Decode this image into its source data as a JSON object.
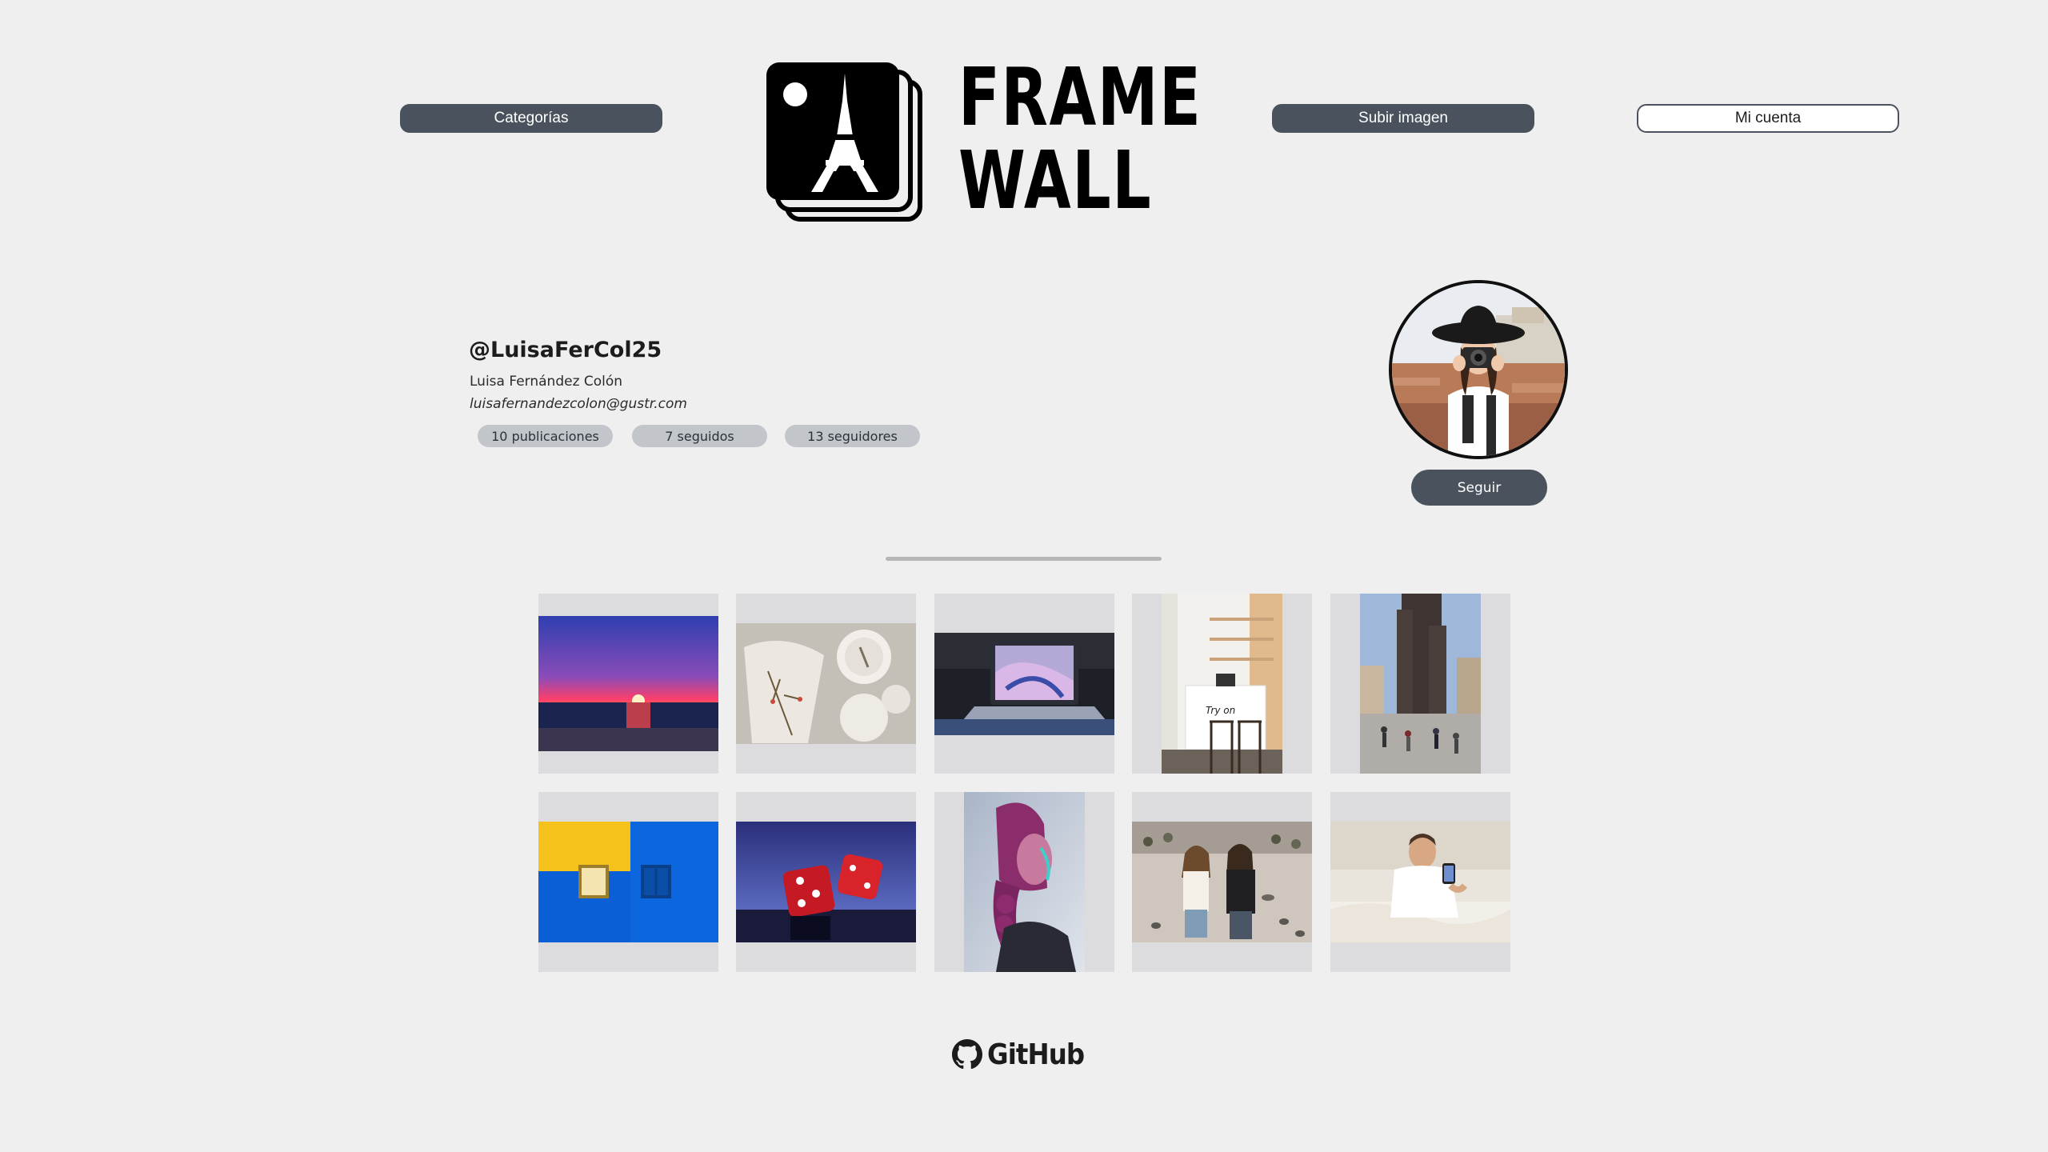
{
  "header": {
    "categories_label": "Categorías",
    "upload_label": "Subir imagen",
    "account_label": "Mi cuenta",
    "logo": {
      "line1": "FRAME",
      "line2": "WALL",
      "icon": "eiffel-tower-photo-stack-icon"
    }
  },
  "profile": {
    "username": "@LuisaFerCol25",
    "full_name": "Luisa Fernández Colón",
    "email": "luisafernandezcolon@gustr.com",
    "stats": {
      "posts": "10 publicaciones",
      "following": "7 seguidos",
      "followers": "13 seguidores"
    },
    "avatar": "photographer-with-hat-photo",
    "follow_label": "Seguir"
  },
  "gallery": {
    "images": [
      "sunset-over-sea-photo",
      "pressed-flowers-dishes-photo",
      "laptop-on-desk-photo",
      "white-shop-counter-photo",
      "gothic-church-square-photo",
      "yellow-blue-wall-photo",
      "red-dice-photo",
      "woman-neon-portrait-photo",
      "women-with-pigeons-photo",
      "man-with-phone-on-bed-photo"
    ]
  },
  "footer": {
    "github_label": "GitHub",
    "icon": "github-icon"
  },
  "colors": {
    "background": "#efefef",
    "button_dark": "#4a535d",
    "stat_badge": "#c2c5c9",
    "tile_placeholder": "#dcdcde"
  }
}
